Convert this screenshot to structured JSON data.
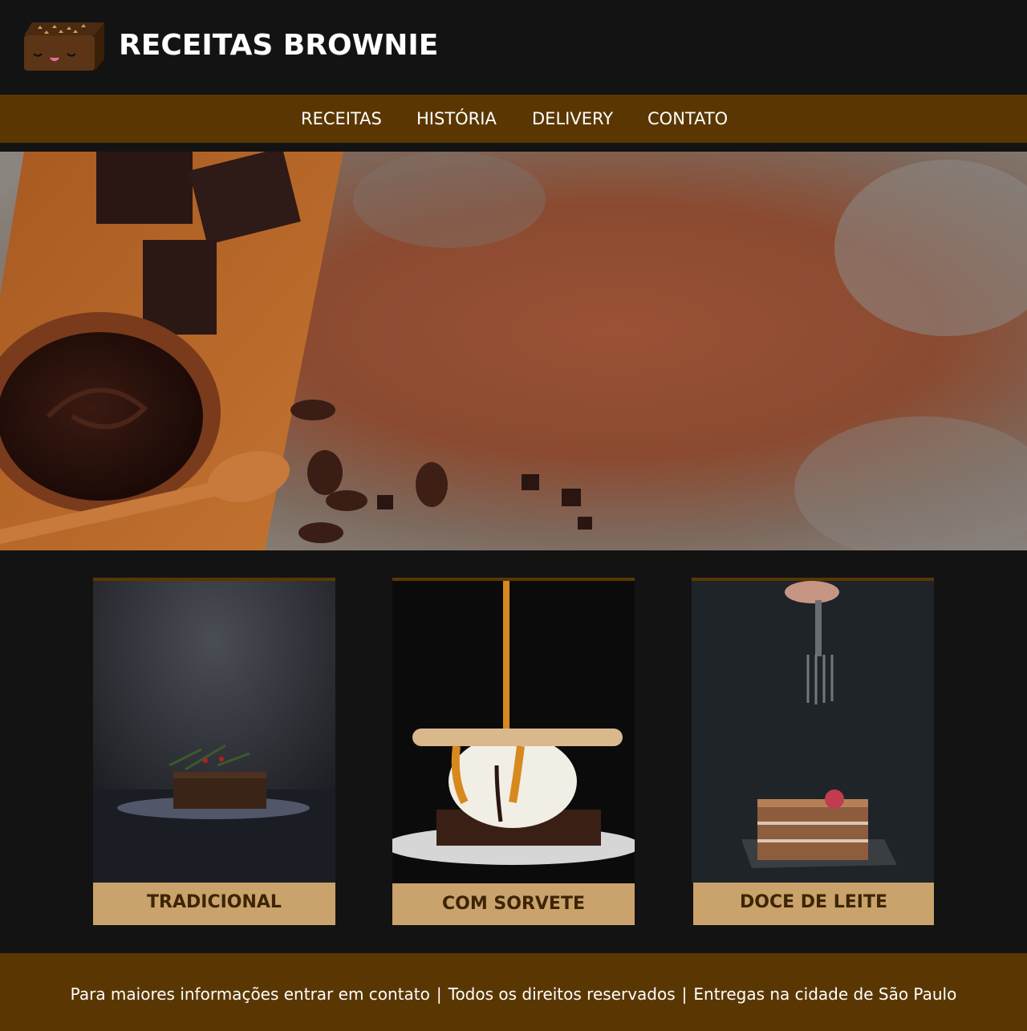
{
  "header": {
    "title": "RECEITAS BROWNIE",
    "logo_icon": "brownie-face-icon"
  },
  "nav": {
    "items": [
      {
        "label": "RECEITAS"
      },
      {
        "label": "HISTÓRIA"
      },
      {
        "label": "DELIVERY"
      },
      {
        "label": "CONTATO"
      }
    ]
  },
  "hero": {
    "image": "chocolate-cocoa-banner"
  },
  "cards": [
    {
      "label": "TRADICIONAL",
      "image": "traditional-brownie-photo"
    },
    {
      "label": "COM SORVETE",
      "image": "brownie-with-ice-cream-photo"
    },
    {
      "label": "DOCE DE LEITE",
      "image": "dulce-de-leche-cake-photo"
    }
  ],
  "footer": {
    "items": [
      "Para maiores informações entrar em contato",
      "Todos os direitos reservados",
      "Entregas na cidade de São Paulo"
    ],
    "separator": "|"
  },
  "colors": {
    "background": "#131313",
    "accent": "#5a3702",
    "card_label_bg": "#c9a26c",
    "card_label_text": "#3d2504"
  }
}
